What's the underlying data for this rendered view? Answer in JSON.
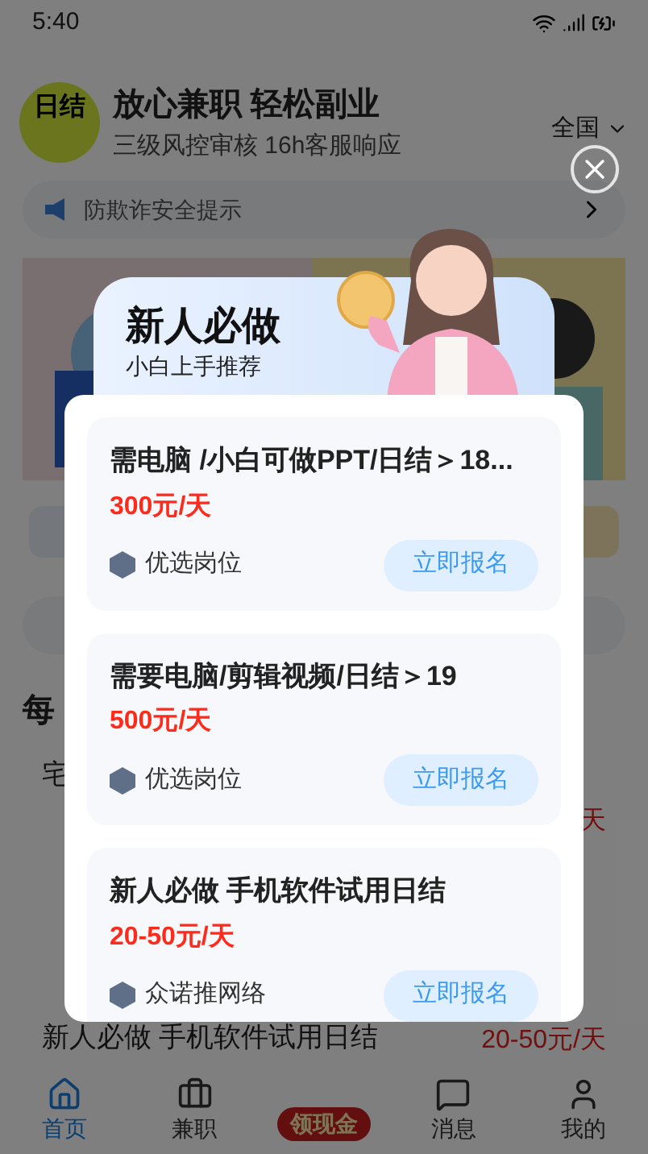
{
  "status_bar": {
    "time": "5:40"
  },
  "header": {
    "logo_text": "日结",
    "title": "放心兼职 轻松副业",
    "subtitle": "三级风控审核 16h客服响应",
    "region": "全国"
  },
  "notice": {
    "text": "防欺诈安全提示"
  },
  "section": {
    "title": "每"
  },
  "list_items": [
    {
      "title": "宅",
      "wage": "天"
    },
    {
      "title": "新人必做 手机软件试用日结",
      "wage": "20-50元/天"
    }
  ],
  "tab_bar": [
    {
      "label": "首页",
      "selected": true,
      "kind": "tab"
    },
    {
      "label": "兼职",
      "selected": false,
      "kind": "tab"
    },
    {
      "label": "领现金",
      "selected": false,
      "kind": "promo"
    },
    {
      "label": "消息",
      "selected": false,
      "kind": "tab"
    },
    {
      "label": "我的",
      "selected": false,
      "kind": "tab"
    }
  ],
  "popup": {
    "title": "新人必做",
    "subtitle": "小白上手推荐",
    "jobs": [
      {
        "title": "需电脑 /小白可做PPT/日结＞18...",
        "wage": "300元/天",
        "company": "优选岗位",
        "button": "立即报名"
      },
      {
        "title": "需要电脑/剪辑视频/日结＞19",
        "wage": "500元/天",
        "company": "优选岗位",
        "button": "立即报名"
      },
      {
        "title": "新人必做 手机软件试用日结",
        "wage": "20-50元/天",
        "company": "众诺推网络",
        "button": "立即报名"
      }
    ]
  }
}
